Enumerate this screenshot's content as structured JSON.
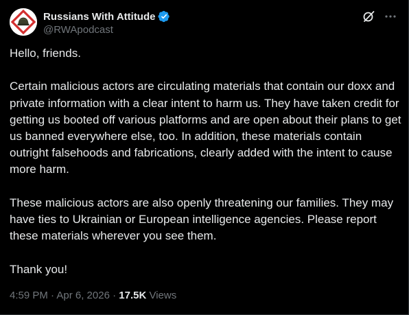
{
  "post": {
    "author": {
      "display_name": "Russians With Attitude",
      "handle": "@RWApodcast",
      "verified": true,
      "avatar_icon": "helmet-diamond-logo"
    },
    "header_icons": [
      "grok-icon",
      "more-icon"
    ],
    "paragraphs": [
      "Hello, friends.",
      "Certain malicious actors are circulating materials that contain our doxx and private information with a clear intent to harm us. They have taken credit for getting us booted off various platforms and are open about their plans to get us banned everywhere else, too. In addition, these materials contain outright falsehoods and fabrications, clearly added with the intent to cause more harm.",
      "These malicious actors are also openly threatening our families. They may have ties to Ukrainian or European intelligence agencies. Please report these materials wherever you see them.",
      "Thank you!"
    ],
    "timestamp": "4:59 PM · Apr 6, 2026",
    "separator": " · ",
    "views_count": "17.5K",
    "views_label": " Views"
  },
  "colors": {
    "background": "#000000",
    "text": "#e7e9ea",
    "secondary": "#71767b",
    "verified": "#1d9bf0",
    "logo_red": "#d32f2f"
  }
}
